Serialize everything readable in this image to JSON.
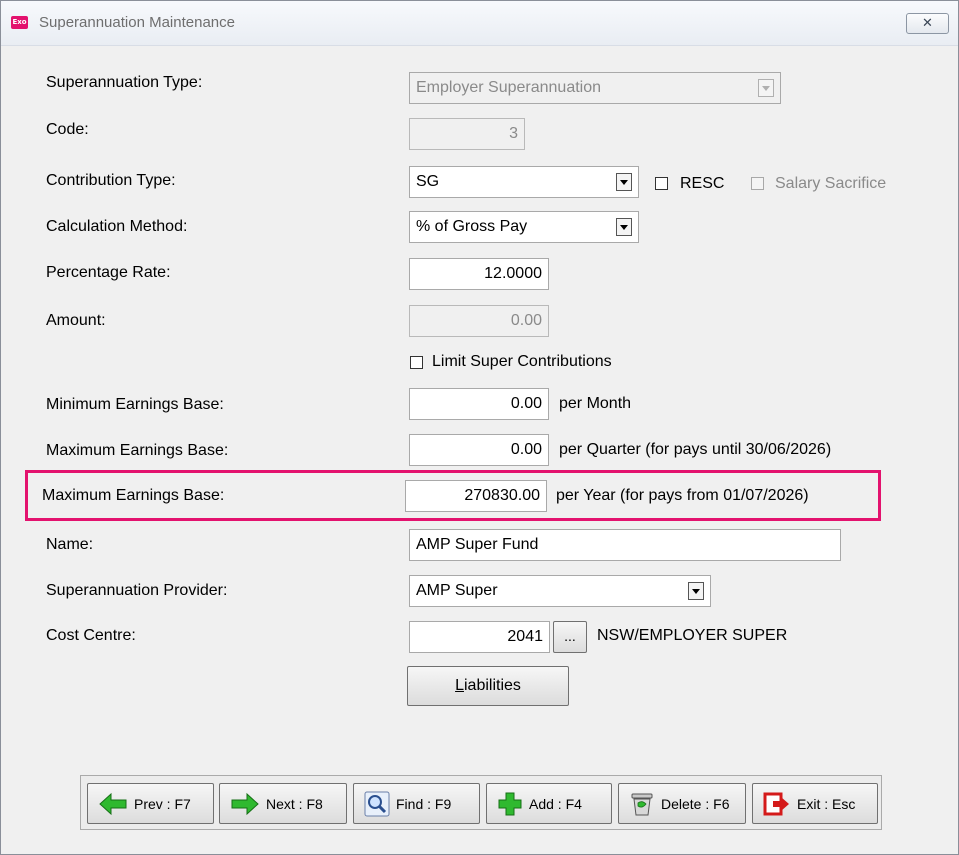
{
  "window": {
    "title": "Superannuation Maintenance",
    "icon": "exo-app-icon",
    "icon_text": "Exo",
    "close": "close-icon"
  },
  "form": {
    "super_type": {
      "label": "Superannuation Type:",
      "value": "Employer Superannuation"
    },
    "code": {
      "label": "Code:",
      "value": "3"
    },
    "contribution_type": {
      "label": "Contribution Type:",
      "value": "SG",
      "resc_label": "RESC",
      "salary_sacrifice_label": "Salary Sacrifice"
    },
    "calc_method": {
      "label": "Calculation Method:",
      "value": "% of Gross Pay"
    },
    "percentage_rate": {
      "label": "Percentage Rate:",
      "value": "12.0000"
    },
    "amount": {
      "label": "Amount:",
      "value": "0.00"
    },
    "limit": {
      "label": "Limit Super Contributions"
    },
    "min_earnings": {
      "label": "Minimum Earnings Base:",
      "value": "0.00",
      "suffix": "per Month"
    },
    "max_earnings_q": {
      "label": "Maximum Earnings Base:",
      "value": "0.00",
      "suffix": "per Quarter (for pays until 30/06/2026)"
    },
    "max_earnings_y": {
      "label": "Maximum Earnings Base:",
      "value": "270830.00",
      "suffix": "per Year (for pays from 01/07/2026)"
    },
    "name": {
      "label": "Name:",
      "value": "AMP Super Fund"
    },
    "provider": {
      "label": "Superannuation Provider:",
      "value": "AMP Super"
    },
    "cost_centre": {
      "label": "Cost Centre:",
      "value": "2041",
      "button": "...",
      "description": "NSW/EMPLOYER SUPER"
    },
    "liabilities_button": {
      "rest": "iabilities",
      "accel": "L"
    }
  },
  "toolbar": {
    "prev": "Prev : F7",
    "next": "Next : F8",
    "find": "Find : F9",
    "add": "Add : F4",
    "delete": "Delete : F6",
    "exit": "Exit : Esc"
  },
  "colors": {
    "highlight": "#e3126e",
    "window_bg": "#f0f0f0"
  }
}
